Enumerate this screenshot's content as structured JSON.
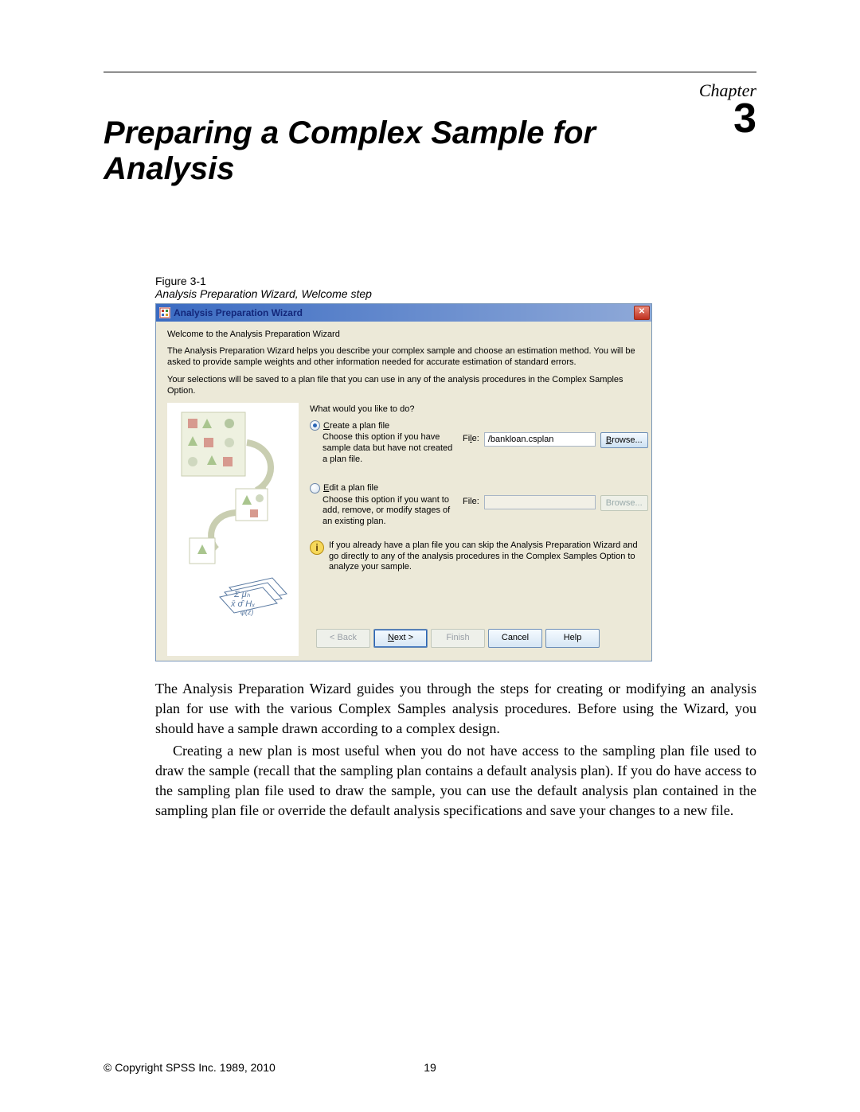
{
  "chapter": {
    "label": "Chapter",
    "number": "3",
    "title": "Preparing a Complex Sample for Analysis"
  },
  "figure": {
    "label": "Figure 3-1",
    "caption": "Analysis Preparation Wizard, Welcome step"
  },
  "wizard": {
    "title": "Analysis Preparation Wizard",
    "welcome": "Welcome to the Analysis Preparation Wizard",
    "desc1": "The Analysis Preparation Wizard helps you describe your complex sample and choose an estimation method. You will be asked to provide sample weights and other information needed for accurate estimation of standard errors.",
    "desc2": "Your selections will be saved to a plan file that you can use in any of the analysis procedures in the Complex Samples Option.",
    "question": "What would you like to do?",
    "create": {
      "label_pre": "C",
      "label_rest": "reate a plan file",
      "desc": "Choose this option if you have sample data but have not created a plan file.",
      "file_label_pre": "Fi",
      "file_label_u": "l",
      "file_label_post": "e:",
      "file_value": "/bankloan.csplan",
      "browse": "Browse..."
    },
    "edit": {
      "label_pre": "E",
      "label_rest": "dit a plan file",
      "desc": "Choose this option if you want to add, remove, or modify stages of an existing plan.",
      "file_label": "File:",
      "browse": "Browse..."
    },
    "info": "If you already have a plan file you can skip the Analysis Preparation Wizard and go directly to any of the analysis procedures in the Complex Samples Option to analyze your sample.",
    "buttons": {
      "back": "< Back",
      "next": "Next >",
      "finish": "Finish",
      "cancel": "Cancel",
      "help": "Help"
    }
  },
  "body": {
    "p1": "The Analysis Preparation Wizard guides you through the steps for creating or modifying an analysis plan for use with the various Complex Samples analysis procedures. Before using the Wizard, you should have a sample drawn according to a complex design.",
    "p2": "Creating a new plan is most useful when you do not have access to the sampling plan file used to draw the sample (recall that the sampling plan contains a default analysis plan). If you do have access to the sampling plan file used to draw the sample, you can use the default analysis plan contained in the sampling plan file or override the default analysis specifications and save your changes to a new file."
  },
  "footer": {
    "copyright": "© Copyright SPSS Inc. 1989, 2010",
    "page": "19"
  }
}
